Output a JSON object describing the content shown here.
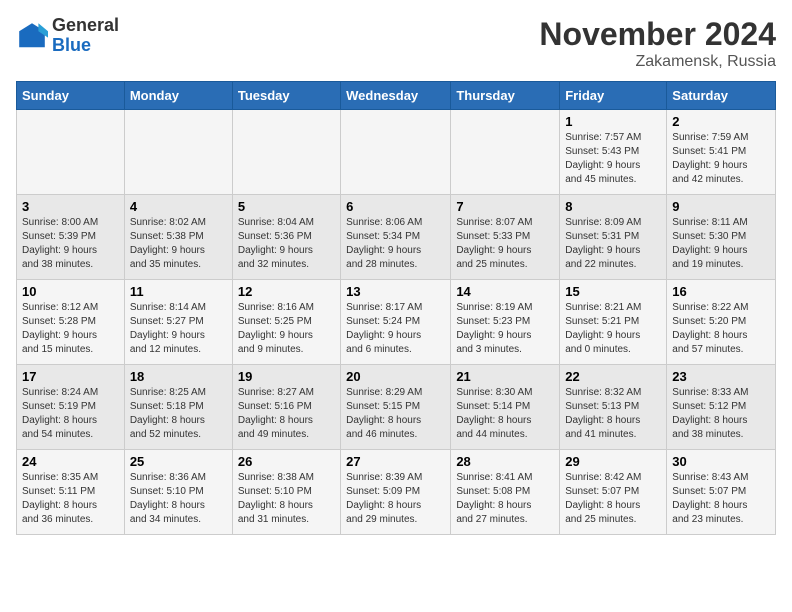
{
  "logo": {
    "general": "General",
    "blue": "Blue"
  },
  "title": "November 2024",
  "location": "Zakamensk, Russia",
  "weekdays": [
    "Sunday",
    "Monday",
    "Tuesday",
    "Wednesday",
    "Thursday",
    "Friday",
    "Saturday"
  ],
  "weeks": [
    [
      {
        "day": "",
        "info": ""
      },
      {
        "day": "",
        "info": ""
      },
      {
        "day": "",
        "info": ""
      },
      {
        "day": "",
        "info": ""
      },
      {
        "day": "",
        "info": ""
      },
      {
        "day": "1",
        "info": "Sunrise: 7:57 AM\nSunset: 5:43 PM\nDaylight: 9 hours\nand 45 minutes."
      },
      {
        "day": "2",
        "info": "Sunrise: 7:59 AM\nSunset: 5:41 PM\nDaylight: 9 hours\nand 42 minutes."
      }
    ],
    [
      {
        "day": "3",
        "info": "Sunrise: 8:00 AM\nSunset: 5:39 PM\nDaylight: 9 hours\nand 38 minutes."
      },
      {
        "day": "4",
        "info": "Sunrise: 8:02 AM\nSunset: 5:38 PM\nDaylight: 9 hours\nand 35 minutes."
      },
      {
        "day": "5",
        "info": "Sunrise: 8:04 AM\nSunset: 5:36 PM\nDaylight: 9 hours\nand 32 minutes."
      },
      {
        "day": "6",
        "info": "Sunrise: 8:06 AM\nSunset: 5:34 PM\nDaylight: 9 hours\nand 28 minutes."
      },
      {
        "day": "7",
        "info": "Sunrise: 8:07 AM\nSunset: 5:33 PM\nDaylight: 9 hours\nand 25 minutes."
      },
      {
        "day": "8",
        "info": "Sunrise: 8:09 AM\nSunset: 5:31 PM\nDaylight: 9 hours\nand 22 minutes."
      },
      {
        "day": "9",
        "info": "Sunrise: 8:11 AM\nSunset: 5:30 PM\nDaylight: 9 hours\nand 19 minutes."
      }
    ],
    [
      {
        "day": "10",
        "info": "Sunrise: 8:12 AM\nSunset: 5:28 PM\nDaylight: 9 hours\nand 15 minutes."
      },
      {
        "day": "11",
        "info": "Sunrise: 8:14 AM\nSunset: 5:27 PM\nDaylight: 9 hours\nand 12 minutes."
      },
      {
        "day": "12",
        "info": "Sunrise: 8:16 AM\nSunset: 5:25 PM\nDaylight: 9 hours\nand 9 minutes."
      },
      {
        "day": "13",
        "info": "Sunrise: 8:17 AM\nSunset: 5:24 PM\nDaylight: 9 hours\nand 6 minutes."
      },
      {
        "day": "14",
        "info": "Sunrise: 8:19 AM\nSunset: 5:23 PM\nDaylight: 9 hours\nand 3 minutes."
      },
      {
        "day": "15",
        "info": "Sunrise: 8:21 AM\nSunset: 5:21 PM\nDaylight: 9 hours\nand 0 minutes."
      },
      {
        "day": "16",
        "info": "Sunrise: 8:22 AM\nSunset: 5:20 PM\nDaylight: 8 hours\nand 57 minutes."
      }
    ],
    [
      {
        "day": "17",
        "info": "Sunrise: 8:24 AM\nSunset: 5:19 PM\nDaylight: 8 hours\nand 54 minutes."
      },
      {
        "day": "18",
        "info": "Sunrise: 8:25 AM\nSunset: 5:18 PM\nDaylight: 8 hours\nand 52 minutes."
      },
      {
        "day": "19",
        "info": "Sunrise: 8:27 AM\nSunset: 5:16 PM\nDaylight: 8 hours\nand 49 minutes."
      },
      {
        "day": "20",
        "info": "Sunrise: 8:29 AM\nSunset: 5:15 PM\nDaylight: 8 hours\nand 46 minutes."
      },
      {
        "day": "21",
        "info": "Sunrise: 8:30 AM\nSunset: 5:14 PM\nDaylight: 8 hours\nand 44 minutes."
      },
      {
        "day": "22",
        "info": "Sunrise: 8:32 AM\nSunset: 5:13 PM\nDaylight: 8 hours\nand 41 minutes."
      },
      {
        "day": "23",
        "info": "Sunrise: 8:33 AM\nSunset: 5:12 PM\nDaylight: 8 hours\nand 38 minutes."
      }
    ],
    [
      {
        "day": "24",
        "info": "Sunrise: 8:35 AM\nSunset: 5:11 PM\nDaylight: 8 hours\nand 36 minutes."
      },
      {
        "day": "25",
        "info": "Sunrise: 8:36 AM\nSunset: 5:10 PM\nDaylight: 8 hours\nand 34 minutes."
      },
      {
        "day": "26",
        "info": "Sunrise: 8:38 AM\nSunset: 5:10 PM\nDaylight: 8 hours\nand 31 minutes."
      },
      {
        "day": "27",
        "info": "Sunrise: 8:39 AM\nSunset: 5:09 PM\nDaylight: 8 hours\nand 29 minutes."
      },
      {
        "day": "28",
        "info": "Sunrise: 8:41 AM\nSunset: 5:08 PM\nDaylight: 8 hours\nand 27 minutes."
      },
      {
        "day": "29",
        "info": "Sunrise: 8:42 AM\nSunset: 5:07 PM\nDaylight: 8 hours\nand 25 minutes."
      },
      {
        "day": "30",
        "info": "Sunrise: 8:43 AM\nSunset: 5:07 PM\nDaylight: 8 hours\nand 23 minutes."
      }
    ]
  ]
}
